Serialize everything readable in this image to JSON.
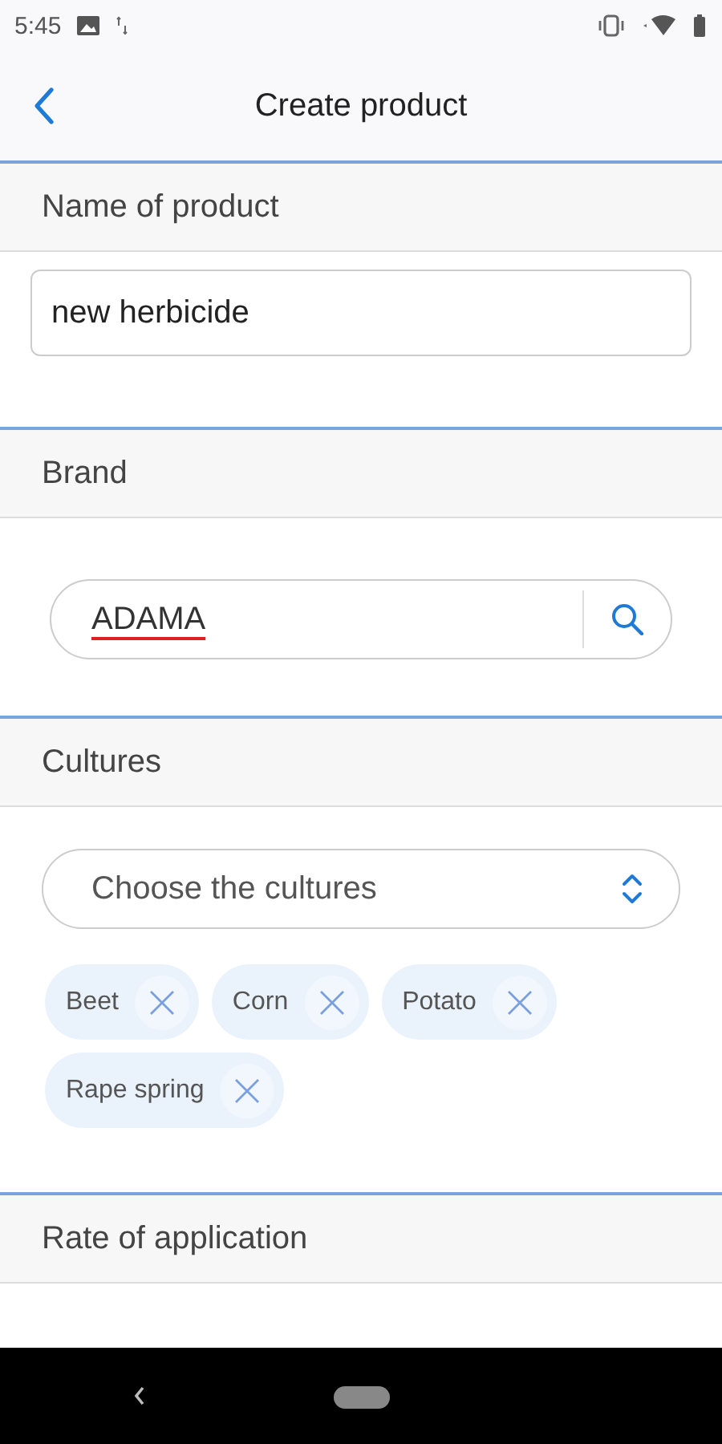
{
  "status_bar": {
    "time": "5:45"
  },
  "header": {
    "title": "Create product"
  },
  "sections": [
    {
      "kind": "text",
      "title": "Name of product",
      "value": "new herbicide"
    },
    {
      "kind": "search",
      "title": "Brand",
      "value": "ADAMA",
      "misspelled": true
    },
    {
      "kind": "select",
      "title": "Cultures",
      "placeholder": "Choose the cultures",
      "chips": [
        "Beet",
        "Corn",
        "Potato",
        "Rape spring"
      ]
    },
    {
      "kind": "partial",
      "title": "Rate of application"
    }
  ]
}
